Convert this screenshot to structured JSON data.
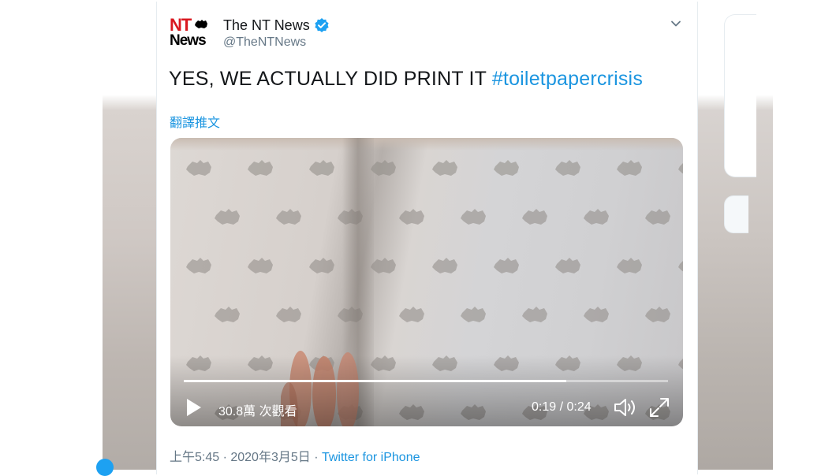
{
  "tweet": {
    "author_name": "The NT News",
    "author_handle": "@TheNTNews",
    "logo_line1": "NT",
    "logo_line2": "News",
    "text": "YES, WE ACTUALLY DID PRINT IT",
    "hashtag": "#toiletpapercrisis",
    "translate_label": "翻譯推文",
    "timestamp": "上午5:45 · 2020年3月5日 · ",
    "source": "Twitter for iPhone"
  },
  "video": {
    "views": "30.8萬 次觀看",
    "time": "0:19 / 0:24",
    "progress_fraction": 0.79
  },
  "icons": {
    "verified": "verified-badge-icon",
    "menu": "chevron-down-icon",
    "play": "play-icon",
    "volume": "volume-icon",
    "fullscreen": "fullscreen-icon"
  },
  "colors": {
    "link": "#1b95e0",
    "verified": "#1da1f2",
    "logo_red": "#d9181f"
  }
}
